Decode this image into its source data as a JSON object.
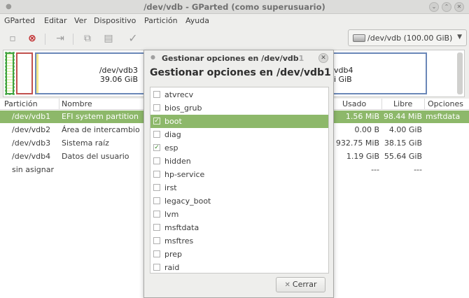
{
  "window": {
    "title": "/dev/vdb - GParted (como superusuario)"
  },
  "menu": [
    "GParted",
    "Editar",
    "Ver",
    "Dispositivo",
    "Partición",
    "Ayuda"
  ],
  "toolbar": {
    "device_label": "/dev/vdb  (100.00 GiB)"
  },
  "graph": {
    "vdb3_name": "/dev/vdb3",
    "vdb3_size": "39.06 GiB",
    "vdb4_name": "vdb4",
    "vdb4_size": "i GiB"
  },
  "table": {
    "headers": {
      "partition": "Partición",
      "name": "Nombre",
      "used": "Usado",
      "free": "Libre",
      "options": "Opciones"
    },
    "rows": [
      {
        "partition": "/dev/vdb1",
        "name": "EFI system partition",
        "used": "1.56 MiB",
        "free": "98.44 MiB",
        "options": "msftdata"
      },
      {
        "partition": "/dev/vdb2",
        "name": "Área de intercambio",
        "used": "0.00 B",
        "free": "4.00 GiB",
        "options": ""
      },
      {
        "partition": "/dev/vdb3",
        "name": "Sistema raíz",
        "used": "932.75 MiB",
        "free": "38.15 GiB",
        "options": ""
      },
      {
        "partition": "/dev/vdb4",
        "name": "Datos del usuario",
        "used": "1.19 GiB",
        "free": "55.64 GiB",
        "options": ""
      },
      {
        "partition": "sin asignar",
        "name": "",
        "used": "---",
        "free": "---",
        "options": ""
      }
    ]
  },
  "dialog": {
    "title_main": "Gestionar opciones en /dev/vdb",
    "title_faded": "1",
    "heading": "Gestionar opciones en /dev/vdb1",
    "close_label": "Cerrar",
    "flags": [
      {
        "label": "atvrecv",
        "checked": false,
        "selected": false
      },
      {
        "label": "bios_grub",
        "checked": false,
        "selected": false
      },
      {
        "label": "boot",
        "checked": true,
        "selected": true
      },
      {
        "label": "diag",
        "checked": false,
        "selected": false
      },
      {
        "label": "esp",
        "checked": true,
        "selected": false
      },
      {
        "label": "hidden",
        "checked": false,
        "selected": false
      },
      {
        "label": "hp-service",
        "checked": false,
        "selected": false
      },
      {
        "label": "irst",
        "checked": false,
        "selected": false
      },
      {
        "label": "legacy_boot",
        "checked": false,
        "selected": false
      },
      {
        "label": "lvm",
        "checked": false,
        "selected": false
      },
      {
        "label": "msftdata",
        "checked": false,
        "selected": false
      },
      {
        "label": "msftres",
        "checked": false,
        "selected": false
      },
      {
        "label": "prep",
        "checked": false,
        "selected": false
      },
      {
        "label": "raid",
        "checked": false,
        "selected": false
      }
    ]
  },
  "colors": {
    "selection": "#8db86a",
    "efi_border": "#3ea23e",
    "swap_border": "#c0504d",
    "ext4_border": "#6a87b8"
  }
}
